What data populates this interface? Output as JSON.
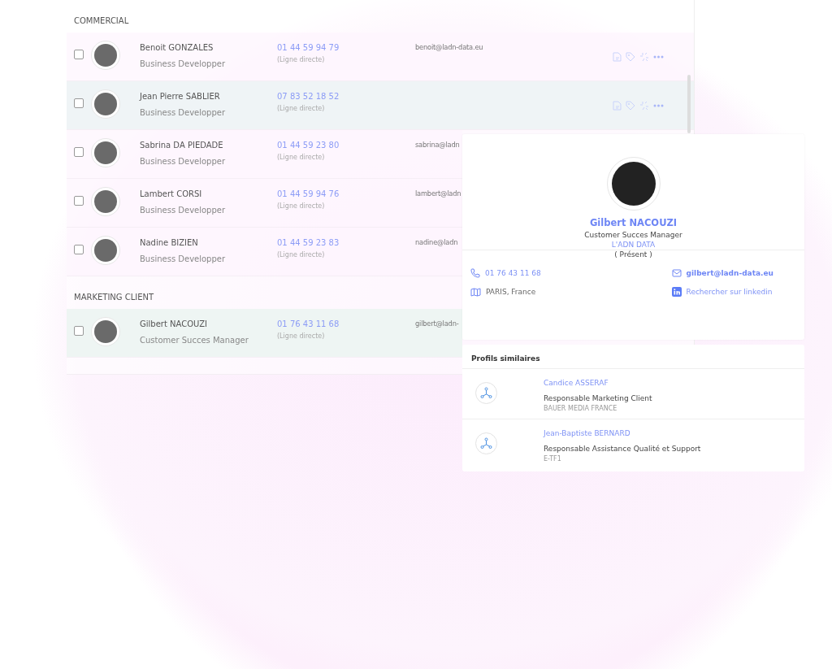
{
  "groups": [
    {
      "title": "COMMERCIAL",
      "contacts": [
        {
          "name": "Benoit GONZALES",
          "role": "Business Developper",
          "phone": "01 44 59 94 79",
          "phone_note": "(Ligne directe)",
          "email": "benoit@ladn-data.eu",
          "highlighted": false,
          "checked": false,
          "show_actions": true
        },
        {
          "name": "Jean Pierre SABLIER",
          "role": "Business Developper",
          "phone": "07 83 52 18 52",
          "phone_note": "(Ligne directe)",
          "highlighted": true,
          "checked": false,
          "show_actions": true
        },
        {
          "name": "Sabrina DA PIEDADE",
          "role": "Business Developper",
          "phone": "01 44 59 23 80",
          "phone_note": "(Ligne directe)",
          "email": "sabrina@ladn",
          "highlighted": false,
          "checked": false
        },
        {
          "name": "Lambert CORSI",
          "role": "Business Developper",
          "phone": "01 44 59 94 76",
          "phone_note": "(Ligne directe)",
          "email": "lambert@ladn",
          "highlighted": false,
          "checked": false
        },
        {
          "name": "Nadine BIZIEN",
          "role": "Business Developper",
          "phone": "01 44 59 23 83",
          "phone_note": "(Ligne directe)",
          "email": "nadine@ladn",
          "highlighted": false,
          "checked": false
        }
      ]
    },
    {
      "title": "MARKETING CLIENT",
      "contacts": [
        {
          "name": "Gilbert NACOUZI",
          "role": "Customer Succes Manager",
          "phone": "01 76 43 11 68",
          "phone_note": "(Ligne directe)",
          "email": "gilbert@ladn-",
          "highlighted": true,
          "checked": false
        }
      ]
    }
  ],
  "profile": {
    "name": "Gilbert NACOUZI",
    "role": "Customer Succes Manager",
    "company": "L'ADN DATA",
    "period": "( Présent )",
    "phone": "01 76 43 11 68",
    "email": "gilbert@ladn-data.eu",
    "location": "PARIS, France",
    "linkedin": "Rechercher sur linkedin"
  },
  "similar": {
    "title": "Profils similaires",
    "profiles": [
      {
        "name": "Candice ASSERAF",
        "role": "Responsable Marketing Client",
        "company": "BAUER MEDIA FRANCE"
      },
      {
        "name": "Jean-Baptiste BERNARD",
        "role": "Responsable Assistance Qualité et Support",
        "company": "E-TF1"
      }
    ]
  }
}
